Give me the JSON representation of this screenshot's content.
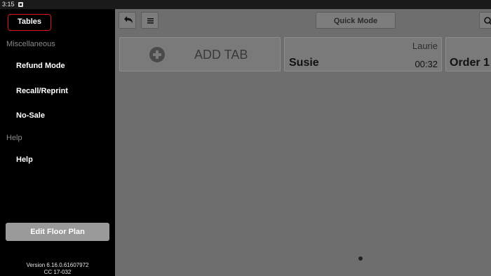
{
  "status_bar": {
    "time": "3:15"
  },
  "sidebar": {
    "tables_label": "Tables",
    "sections": [
      {
        "title": "Miscellaneous",
        "items": [
          "Refund Mode",
          "Recall/Reprint",
          "No-Sale"
        ]
      },
      {
        "title": "Help",
        "items": [
          "Help"
        ]
      }
    ],
    "edit_floor_plan_label": "Edit Floor Plan",
    "version_line1": "Version 6.16.0.61607972",
    "version_line2": "CC 17-032"
  },
  "toolbar": {
    "quick_mode_label": "Quick Mode"
  },
  "tabs": {
    "add_tab_label": "ADD TAB",
    "cards": [
      {
        "server": "Laurie",
        "name": "Susie",
        "timer": "00:32"
      },
      {
        "name": "Order 1"
      }
    ]
  },
  "colors": {
    "tables_outline": "#e0141e",
    "main_background": "#6e6e6e",
    "sidebar_background": "#000000"
  }
}
